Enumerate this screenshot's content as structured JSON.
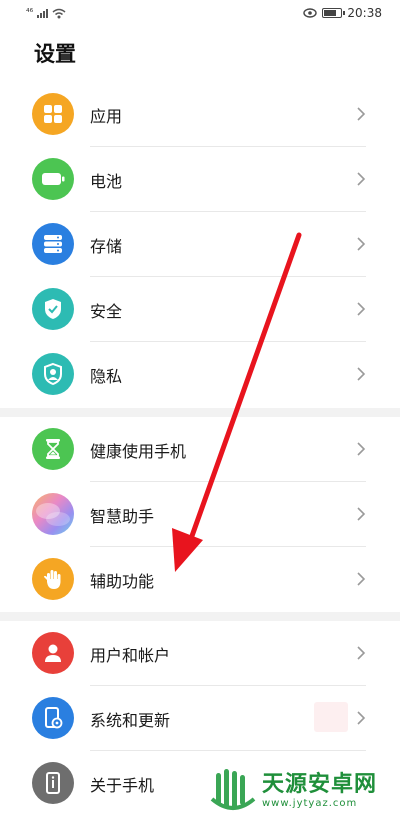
{
  "status_bar": {
    "network": "⁴⁶",
    "time": "20:38"
  },
  "page": {
    "title": "设置"
  },
  "groups": [
    {
      "items": [
        {
          "label": "应用",
          "icon": "apps-grid-icon",
          "color": "#f5a623"
        },
        {
          "label": "电池",
          "icon": "battery-icon",
          "color": "#4cc552"
        },
        {
          "label": "存储",
          "icon": "storage-icon",
          "color": "#2a7fe0"
        },
        {
          "label": "安全",
          "icon": "shield-check-icon",
          "color": "#2dbbb3"
        },
        {
          "label": "隐私",
          "icon": "privacy-shield-icon",
          "color": "#2dbbb3"
        }
      ]
    },
    {
      "items": [
        {
          "label": "健康使用手机",
          "icon": "hourglass-icon",
          "color": "#4cc552"
        },
        {
          "label": "智慧助手",
          "icon": "smart-assistant-icon",
          "color": "#d98ac9"
        },
        {
          "label": "辅助功能",
          "icon": "hand-icon",
          "color": "#f5a623"
        }
      ]
    },
    {
      "items": [
        {
          "label": "用户和帐户",
          "icon": "user-icon",
          "color": "#e8403a"
        },
        {
          "label": "系统和更新",
          "icon": "system-update-icon",
          "color": "#2a7fe0"
        },
        {
          "label": "关于手机",
          "icon": "phone-info-icon",
          "color": "#6e6e6e"
        }
      ]
    }
  ],
  "watermark": {
    "name": "天源安卓网",
    "url": "www.jytyaz.com"
  },
  "colors": {
    "arrow": "#e8141e",
    "chevron": "#9a9a9a",
    "separator": "#f2f2f2"
  }
}
